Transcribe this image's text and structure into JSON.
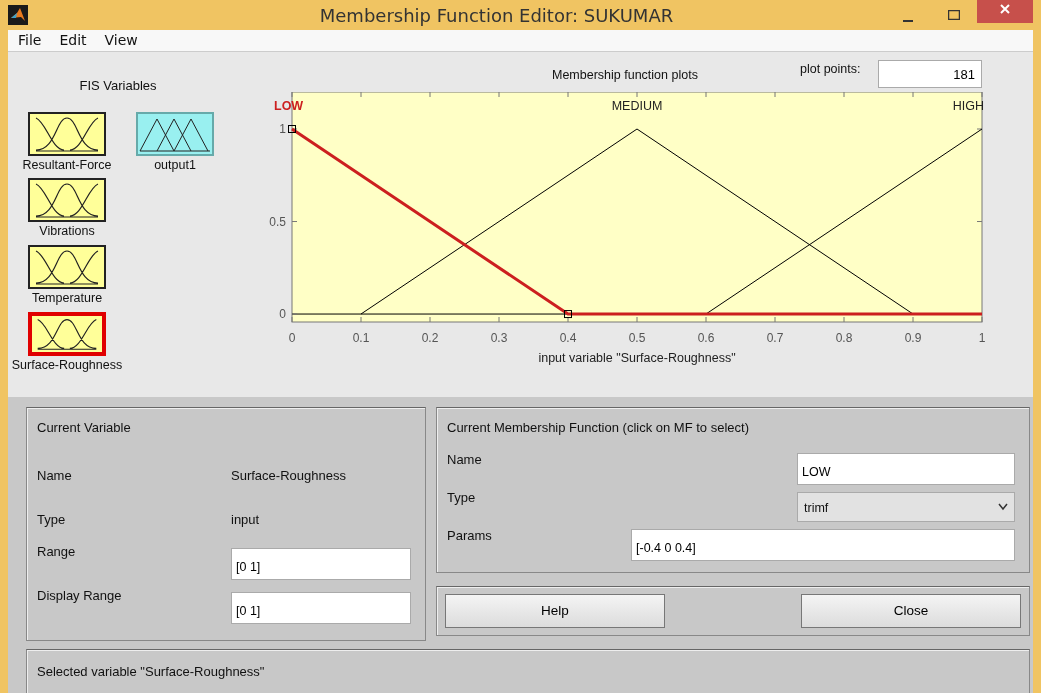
{
  "window": {
    "title": "Membership Function Editor: SUKUMAR"
  },
  "menu": [
    "File",
    "Edit",
    "View"
  ],
  "fis_variables": {
    "title": "FIS Variables",
    "items": [
      {
        "name": "Resultant-Force",
        "kind": "input",
        "selected": false
      },
      {
        "name": "output1",
        "kind": "output",
        "selected": false
      },
      {
        "name": "Vibrations",
        "kind": "input",
        "selected": false
      },
      {
        "name": "Temperature",
        "kind": "input",
        "selected": false
      },
      {
        "name": "Surface-Roughness",
        "kind": "input",
        "selected": true
      }
    ]
  },
  "plot": {
    "title": "Membership function plots",
    "plot_points_label": "plot points:",
    "plot_points": "181",
    "chart_data": {
      "type": "line",
      "xlabel": "input variable \"Surface-Roughness\"",
      "x": [
        0,
        0.1,
        0.4,
        0.5,
        0.6,
        0.9,
        1
      ],
      "series": [
        {
          "name": "LOW",
          "color": "#cc1f1f",
          "values": [
            1,
            0.75,
            0,
            0,
            0,
            0,
            0
          ]
        },
        {
          "name": "MEDIUM",
          "color": "#000000",
          "values": [
            null,
            0,
            0.75,
            1,
            0.75,
            0,
            null
          ]
        },
        {
          "name": "HIGH",
          "color": "#000000",
          "values": [
            null,
            null,
            null,
            null,
            0,
            0.75,
            1
          ]
        }
      ],
      "xlim": [
        0,
        1
      ],
      "ylim": [
        -0.043,
        1.2
      ],
      "xticks": [
        0,
        0.1,
        0.2,
        0.3,
        0.4,
        0.5,
        0.6,
        0.7,
        0.8,
        0.9,
        1
      ],
      "yticks": [
        0,
        0.5,
        1
      ]
    }
  },
  "current_variable": {
    "title": "Current Variable",
    "rows": [
      {
        "label": "Name",
        "value": "Surface-Roughness",
        "kind": "text"
      },
      {
        "label": "Type",
        "value": "input",
        "kind": "text"
      },
      {
        "label": "Range",
        "value": "[0 1]",
        "kind": "field"
      },
      {
        "label": "Display Range",
        "value": "[0 1]",
        "kind": "field"
      }
    ]
  },
  "current_mf": {
    "title": "Current Membership Function (click on MF to select)",
    "name_label": "Name",
    "name": "LOW",
    "type_label": "Type",
    "type": "trimf",
    "params_label": "Params",
    "params": "[-0.4 0 0.4]"
  },
  "buttons": [
    "Help",
    "Close"
  ],
  "status": "Selected variable \"Surface-Roughness\""
}
